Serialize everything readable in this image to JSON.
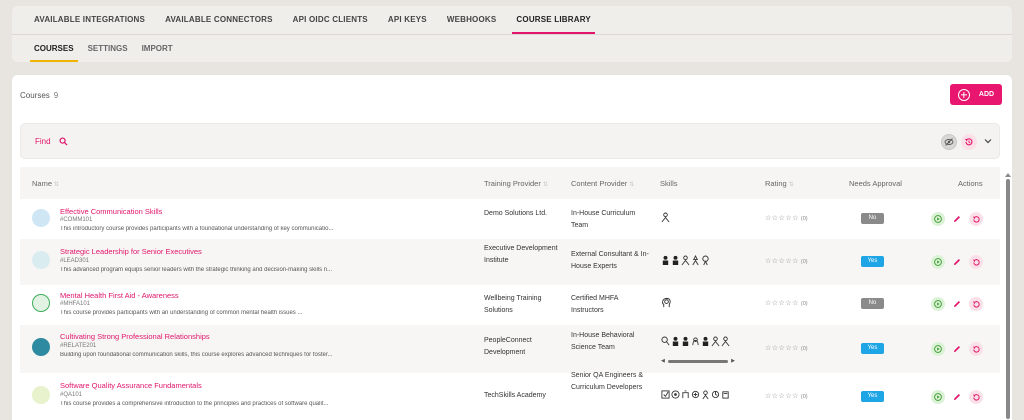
{
  "top_tabs": [
    {
      "label": "AVAILABLE INTEGRATIONS",
      "active": false
    },
    {
      "label": "AVAILABLE CONNECTORS",
      "active": false
    },
    {
      "label": "API OIDC CLIENTS",
      "active": false
    },
    {
      "label": "API KEYS",
      "active": false
    },
    {
      "label": "WEBHOOKS",
      "active": false
    },
    {
      "label": "COURSE LIBRARY",
      "active": true
    }
  ],
  "sub_tabs": [
    {
      "label": "COURSES",
      "active": true
    },
    {
      "label": "SETTINGS",
      "active": false
    },
    {
      "label": "IMPORT",
      "active": false
    }
  ],
  "courses_header": {
    "label": "Courses",
    "count": "9"
  },
  "add_button": {
    "label": "ADD"
  },
  "find": {
    "label": "Find"
  },
  "columns": {
    "name": "Name",
    "training_provider": "Training Provider",
    "content_provider": "Content Provider",
    "skills": "Skills",
    "rating": "Rating",
    "needs_approval": "Needs Approval",
    "actions": "Actions"
  },
  "rows": [
    {
      "title": "Effective Communication Skills",
      "code": "#COMM101",
      "description": "This introductory course provides participants with a foundational understanding of key communicatio...",
      "training_provider": "Demo Solutions Ltd.",
      "content_provider": "In-House Curriculum Team",
      "rating_count": "(0)",
      "approval": "No",
      "thumb_color": "#7fb8e0"
    },
    {
      "title": "Strategic Leadership for Senior Executives",
      "code": "#LEAD301",
      "description": "This advanced program equips senior leaders with the strategic thinking and decision-making skills n...",
      "training_provider": "Executive Development Institute",
      "content_provider": "External Consultant & In-House Experts",
      "rating_count": "(0)",
      "approval": "Yes",
      "thumb_color": "#3a7d8c"
    },
    {
      "title": "Mental Health First Aid - Awareness",
      "code": "#MHFA101",
      "description": "This course provides participants with an understanding of common mental health issues ...",
      "training_provider": "Wellbeing Training Solutions",
      "content_provider": "Certified MHFA Instructors",
      "rating_count": "(0)",
      "approval": "No",
      "thumb_color": "#3fae5a"
    },
    {
      "title": "Cultivating Strong Professional Relationships",
      "code": "#RELATE201",
      "description": "Building upon foundational communication skills, this course explores advanced techniques for foster...",
      "training_provider": "PeopleConnect Development",
      "content_provider": "In-House Behavioral Science Team",
      "rating_count": "(0)",
      "approval": "Yes",
      "thumb_color": "#2e8aa0"
    },
    {
      "title": "Software Quality Assurance Fundamentals",
      "code": "#QA101",
      "description": "This course provides a comprehensive introduction to the principles and practices of software qualit...",
      "training_provider": "TechSkills Academy",
      "content_provider": "Senior QA Engineers & Curriculum Developers",
      "rating_count": "(0)",
      "approval": "Yes",
      "thumb_color": "#9cc43a"
    }
  ],
  "colors": {
    "accent": "#e0156b",
    "yes": "#1ea5e6",
    "no": "#8a8a8a"
  }
}
